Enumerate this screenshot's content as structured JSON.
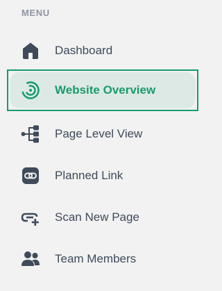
{
  "sidebar": {
    "heading": "MENU",
    "accent_color": "#159b6e",
    "icon_color": "#3f4a5a",
    "items": [
      {
        "label": "Dashboard",
        "icon": "home-icon",
        "active": false
      },
      {
        "label": "Website Overview",
        "icon": "gauge-icon",
        "active": true
      },
      {
        "label": "Page Level View",
        "icon": "tree-icon",
        "active": false
      },
      {
        "label": "Planned Link",
        "icon": "link-icon",
        "active": false
      },
      {
        "label": "Scan New Page",
        "icon": "add-link-icon",
        "active": false
      },
      {
        "label": "Team Members",
        "icon": "team-icon",
        "active": false
      }
    ]
  }
}
